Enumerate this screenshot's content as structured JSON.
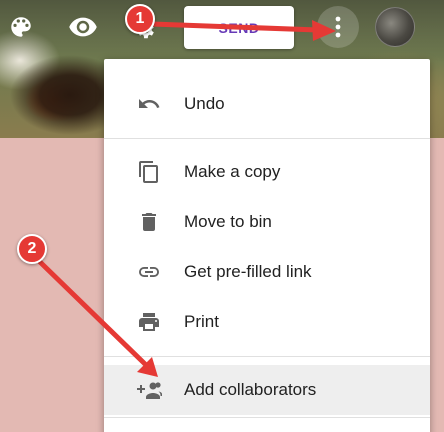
{
  "header": {
    "icons": [
      "palette-icon",
      "eye-icon",
      "settings-icon",
      "more-vert-icon"
    ],
    "send_label": "SEND"
  },
  "menu": {
    "items": [
      {
        "label": "Undo",
        "icon": "undo-icon"
      },
      {
        "label": "Make a copy",
        "icon": "copy-icon"
      },
      {
        "label": "Move to bin",
        "icon": "trash-icon"
      },
      {
        "label": "Get pre-filled link",
        "icon": "link-icon"
      },
      {
        "label": "Print",
        "icon": "print-icon"
      },
      {
        "label": "Add collaborators",
        "icon": "add-people-icon",
        "highlighted": true
      }
    ]
  },
  "annotations": {
    "step1": "1",
    "step2": "2",
    "color": "#e53935"
  },
  "colors": {
    "send_text": "#673ab7",
    "icon_gray": "#616161",
    "background": "#e3b9b3"
  }
}
